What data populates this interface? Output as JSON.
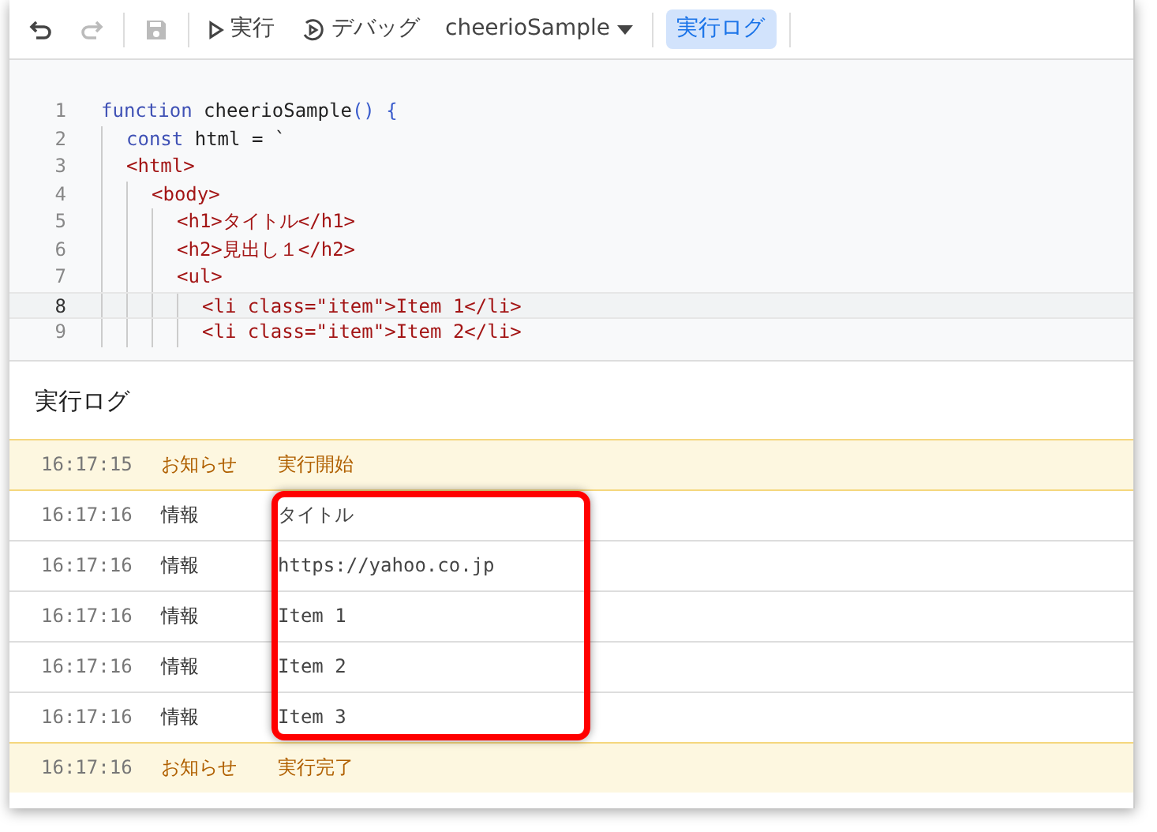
{
  "toolbar": {
    "undo": {
      "disabled": false
    },
    "redo": {
      "disabled": true
    },
    "save": {
      "disabled": true
    },
    "run": "実行",
    "debug": "デバッグ",
    "function_select": "cheerioSample",
    "log_button": {
      "label": "実行ログ",
      "selected": true
    }
  },
  "editor": {
    "lines": [
      {
        "number": "1",
        "current": false,
        "tokens": [
          {
            "text": "function",
            "kind": "keyword"
          },
          {
            "text": " cheerioSample",
            "kind": "plain"
          },
          {
            "text": "()",
            "kind": "bracket"
          },
          {
            "text": " {",
            "kind": "bracket"
          }
        ],
        "children": [
          {
            "number": "2",
            "current": false,
            "tokens": [
              {
                "text": "const",
                "kind": "keyword"
              },
              {
                "text": " html = `",
                "kind": "plain"
              }
            ]
          },
          {
            "number": "3",
            "current": false,
            "tokens": [
              {
                "text": "<html>",
                "kind": "string"
              }
            ],
            "children": [
              {
                "number": "4",
                "current": false,
                "tokens": [
                  {
                    "text": "<body>",
                    "kind": "string"
                  }
                ],
                "children": [
                  {
                    "number": "5",
                    "current": false,
                    "tokens": [
                      {
                        "text": "<h1>タイトル</h1>",
                        "kind": "string"
                      }
                    ]
                  },
                  {
                    "number": "6",
                    "current": false,
                    "tokens": [
                      {
                        "text": "<h2>見出し１</h2>",
                        "kind": "string"
                      }
                    ]
                  },
                  {
                    "number": "7",
                    "current": false,
                    "tokens": [
                      {
                        "text": "<ul>",
                        "kind": "string"
                      }
                    ],
                    "children": [
                      {
                        "number": "8",
                        "current": true,
                        "tokens": [
                          {
                            "text": "<li class=\"item\">Item 1</li>",
                            "kind": "string"
                          }
                        ]
                      },
                      {
                        "number": "9",
                        "current": false,
                        "tokens": [
                          {
                            "text": "<li class=\"item\">Item 2</li>",
                            "kind": "string"
                          }
                        ]
                      }
                    ]
                  }
                ]
              }
            ]
          }
        ]
      }
    ]
  },
  "log": {
    "title": "実行ログ",
    "rows": [
      {
        "time": "16:17:15",
        "level": "お知らせ",
        "kind": "notice",
        "message": "実行開始",
        "highlighted": false
      },
      {
        "time": "16:17:16",
        "level": "情報",
        "kind": "info",
        "message": "タイトル",
        "highlighted": true
      },
      {
        "time": "16:17:16",
        "level": "情報",
        "kind": "info",
        "message": "https://yahoo.co.jp",
        "highlighted": true
      },
      {
        "time": "16:17:16",
        "level": "情報",
        "kind": "info",
        "message": "Item 1",
        "highlighted": true
      },
      {
        "time": "16:17:16",
        "level": "情報",
        "kind": "info",
        "message": "Item 2",
        "highlighted": true
      },
      {
        "time": "16:17:16",
        "level": "情報",
        "kind": "info",
        "message": "Item 3",
        "highlighted": true
      },
      {
        "time": "16:17:16",
        "level": "お知らせ",
        "kind": "notice",
        "message": "実行完了",
        "highlighted": false
      }
    ]
  }
}
